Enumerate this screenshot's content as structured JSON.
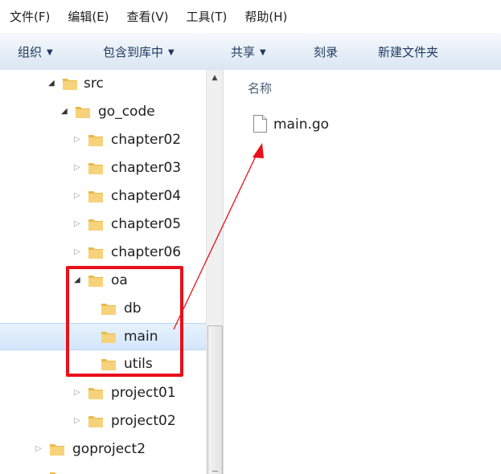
{
  "menubar": [
    {
      "label": "文件(F)"
    },
    {
      "label": "编辑(E)"
    },
    {
      "label": "查看(V)"
    },
    {
      "label": "工具(T)"
    },
    {
      "label": "帮助(H)"
    }
  ],
  "toolbar": {
    "organize": "组织",
    "include_library": "包含到库中",
    "share": "共享",
    "burn": "刻录",
    "new_folder": "新建文件夹"
  },
  "tree": [
    {
      "label": "src",
      "state": "expanded"
    },
    {
      "label": "go_code",
      "state": "expanded"
    },
    {
      "label": "chapter02",
      "state": "collapsed"
    },
    {
      "label": "chapter03",
      "state": "collapsed"
    },
    {
      "label": "chapter04",
      "state": "collapsed"
    },
    {
      "label": "chapter05",
      "state": "collapsed"
    },
    {
      "label": "chapter06",
      "state": "collapsed"
    },
    {
      "label": "oa",
      "state": "expanded"
    },
    {
      "label": "db",
      "state": "leaf"
    },
    {
      "label": "main",
      "state": "leaf",
      "selected": true
    },
    {
      "label": "utils",
      "state": "leaf"
    },
    {
      "label": "project01",
      "state": "collapsed"
    },
    {
      "label": "project02",
      "state": "collapsed"
    },
    {
      "label": "goproject2",
      "state": "collapsed"
    }
  ],
  "content": {
    "column_name": "名称",
    "files": [
      {
        "name": "main.go",
        "icon": "document-icon"
      }
    ]
  },
  "annotations": {
    "highlight_color": "#e8101a",
    "arrow_color": "#e8101a"
  },
  "colors": {
    "selection": "#d3e7fb",
    "folder": "#e9b949",
    "toolbar_text": "#1e3a5f"
  }
}
